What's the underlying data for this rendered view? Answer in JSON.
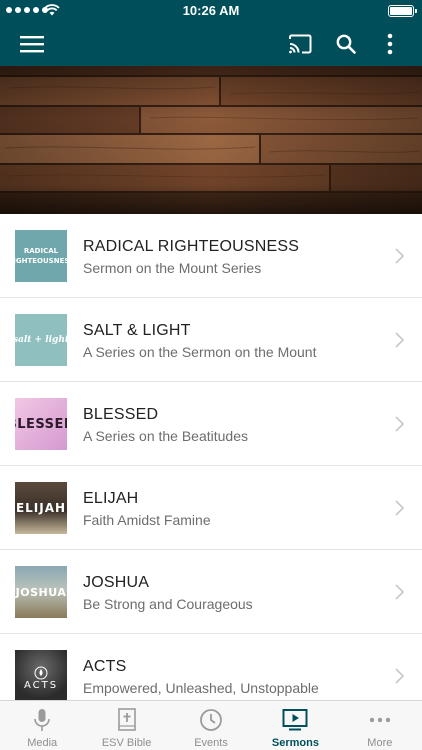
{
  "status_bar": {
    "time": "10:26 AM"
  },
  "toolbar": {
    "menu_icon": "hamburger-icon",
    "cast_icon": "cast-icon",
    "search_icon": "search-icon",
    "more_icon": "more-vertical-icon",
    "color": "#004e5a"
  },
  "sermons": [
    {
      "title": "RADICAL RIGHTEOUSNESS",
      "subtitle": "Sermon on the Mount Series",
      "thumb_text": "RADICAL\nRIGHTEOUSNESS"
    },
    {
      "title": "SALT & LIGHT",
      "subtitle": "A Series on the Sermon on the Mount",
      "thumb_text": "salt + light"
    },
    {
      "title": "BLESSED",
      "subtitle": "A Series on the Beatitudes",
      "thumb_text": "BLESSED"
    },
    {
      "title": "ELIJAH",
      "subtitle": "Faith Amidst Famine",
      "thumb_text": "ELIJAH"
    },
    {
      "title": "JOSHUA",
      "subtitle": "Be Strong and Courageous",
      "thumb_text": "JOSHUA"
    },
    {
      "title": "ACTS",
      "subtitle": "Empowered, Unleashed, Unstoppable",
      "thumb_text": "ACTS"
    }
  ],
  "tabs": [
    {
      "label": "Media",
      "icon": "microphone-icon",
      "active": false
    },
    {
      "label": "ESV Bible",
      "icon": "bible-icon",
      "active": false
    },
    {
      "label": "Events",
      "icon": "clock-icon",
      "active": false
    },
    {
      "label": "Sermons",
      "icon": "play-screen-icon",
      "active": true
    },
    {
      "label": "More",
      "icon": "more-horizontal-icon",
      "active": false
    }
  ],
  "colors": {
    "accent": "#004e5a",
    "tab_inactive": "#8e8e8e"
  }
}
